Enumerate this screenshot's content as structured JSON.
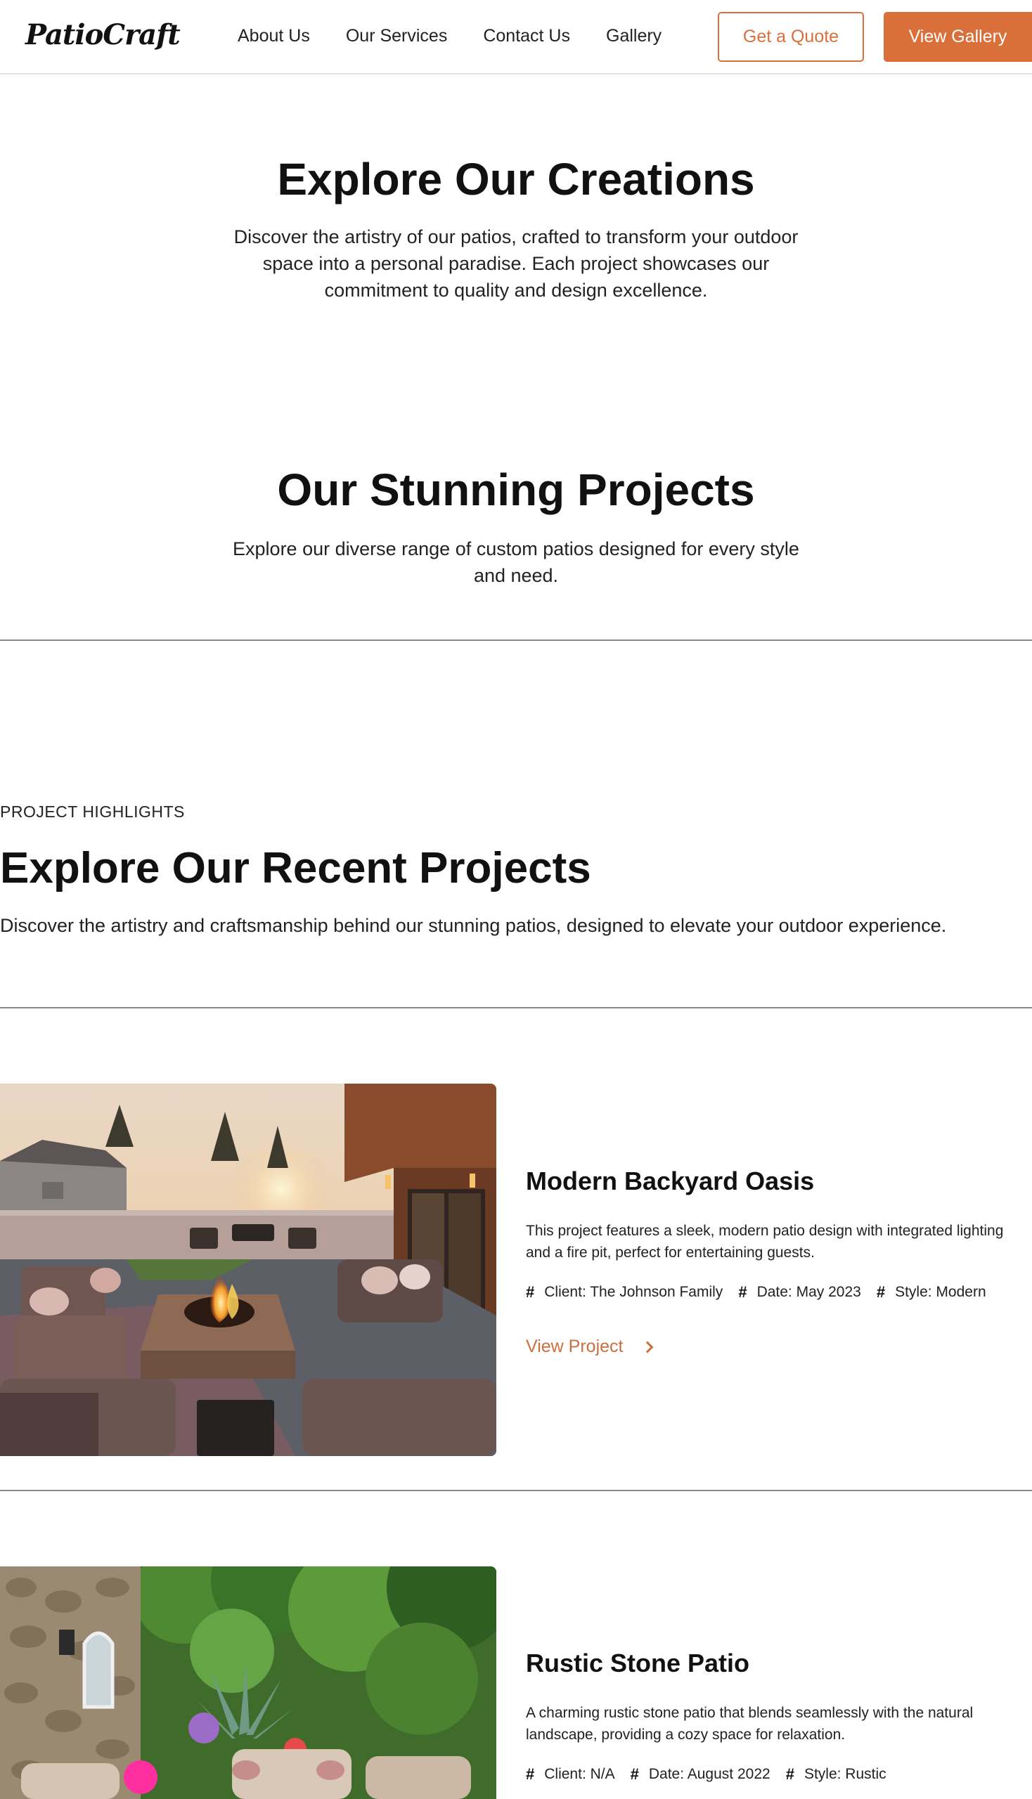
{
  "header": {
    "logo": "PatioCraft",
    "nav": [
      "About Us",
      "Our Services",
      "Contact Us",
      "Gallery"
    ],
    "quote_button": "Get a Quote",
    "gallery_button": "View Gallery"
  },
  "hero": {
    "title": "Explore Our Creations",
    "text": "Discover the artistry of our patios, crafted to transform your outdoor space into a personal paradise. Each project showcases our commitment to quality and design excellence."
  },
  "projects_intro": {
    "title": "Our Stunning Projects",
    "text": "Explore our diverse range of custom patios designed for every style and need."
  },
  "recent": {
    "eyebrow": "PROJECT HIGHLIGHTS",
    "title": "Explore Our Recent Projects",
    "text": "Discover the artistry and craftsmanship behind our stunning patios, designed to elevate your outdoor experience."
  },
  "projects": [
    {
      "title": "Modern Backyard Oasis",
      "description": "This project features a sleek, modern patio design with integrated lighting and a fire pit, perfect for entertaining guests.",
      "meta": [
        "Client: The Johnson Family",
        "Date: May 2023",
        "Style: Modern"
      ],
      "link": "View Project"
    },
    {
      "title": "Rustic Stone Patio",
      "description": "A charming rustic stone patio that blends seamlessly with the natural landscape, providing a cozy space for relaxation.",
      "meta": [
        "Client: N/A",
        "Date: August 2022",
        "Style: Rustic"
      ]
    }
  ],
  "colors": {
    "accent": "#d9703a",
    "link": "#c9703e",
    "text": "#111111"
  }
}
